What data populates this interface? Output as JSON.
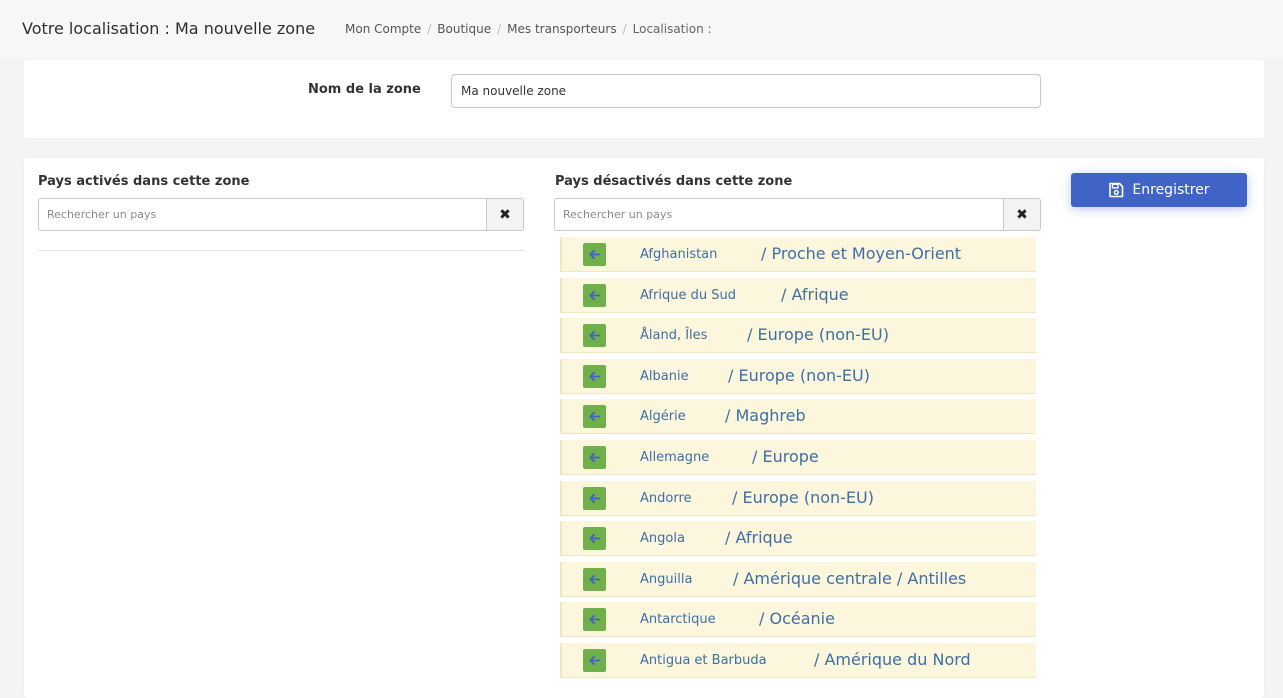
{
  "header": {
    "title": "Votre localisation : Ma nouvelle zone",
    "breadcrumb": [
      {
        "label": "Mon Compte"
      },
      {
        "label": "Boutique"
      },
      {
        "label": "Mes transporteurs"
      },
      {
        "label": "Localisation :"
      }
    ]
  },
  "zone": {
    "label": "Nom de la zone",
    "value": "Ma nouvelle zone"
  },
  "active_column": {
    "title": "Pays activés dans cette zone",
    "search_placeholder": "Rechercher un pays",
    "clear_symbol": "✖"
  },
  "inactive_column": {
    "title": "Pays désactivés dans cette zone",
    "search_placeholder": "Rechercher un pays",
    "clear_symbol": "✖"
  },
  "save_button": {
    "label": "Enregistrer",
    "icon": "floppy-disk-icon"
  },
  "countries": [
    {
      "name": "Afghanistan",
      "region": "/ Proche et Moyen-Orient"
    },
    {
      "name": "Afrique du Sud",
      "region": "/ Afrique"
    },
    {
      "name": "Åland, Îles",
      "region": "/ Europe (non-EU)"
    },
    {
      "name": "Albanie",
      "region": "/ Europe (non-EU)"
    },
    {
      "name": "Algérie",
      "region": "/ Maghreb"
    },
    {
      "name": "Allemagne",
      "region": "/ Europe"
    },
    {
      "name": "Andorre",
      "region": "/ Europe (non-EU)"
    },
    {
      "name": "Angola",
      "region": "/ Afrique"
    },
    {
      "name": "Anguilla",
      "region": "/ Amérique centrale / Antilles"
    },
    {
      "name": "Antarctique",
      "region": "/ Océanie"
    },
    {
      "name": "Antigua et Barbuda",
      "region": "/ Amérique du Nord"
    }
  ],
  "colors": {
    "primary": "#3f63c7",
    "move_button": "#6fb04a",
    "row_background": "#fcf6dc",
    "link_text": "#3f6fa6"
  }
}
